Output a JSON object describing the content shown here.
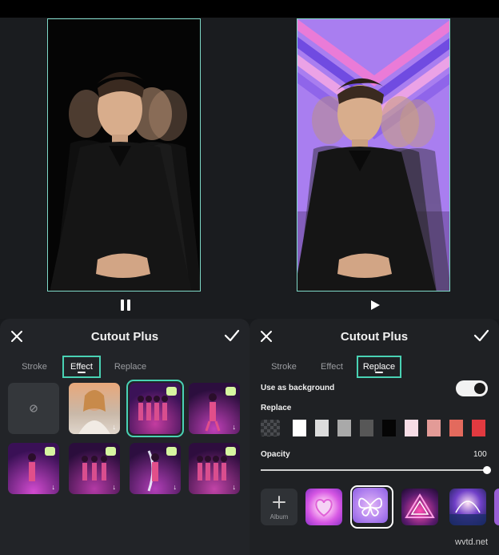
{
  "left_panel": {
    "title": "Cutout Plus",
    "tabs": [
      "Stroke",
      "Effect",
      "Replace"
    ],
    "active_tab": "Effect",
    "effects": [
      {
        "name": "none-effect-icon"
      },
      {
        "name": "portrait-effect",
        "download": "↓"
      },
      {
        "name": "dancer-trail-effect",
        "premium": true,
        "selected": true
      },
      {
        "name": "dancer-spotlight-effect",
        "premium": true,
        "download": "↓"
      },
      {
        "name": "dancer-neon-effect",
        "premium": true,
        "download": "↓"
      },
      {
        "name": "dancer-shadow-effect",
        "premium": true,
        "download": "↓"
      },
      {
        "name": "dancer-glow-effect",
        "premium": true,
        "download": "↓"
      },
      {
        "name": "dancer-echo-effect",
        "premium": true,
        "download": "↓"
      }
    ]
  },
  "right_panel": {
    "title": "Cutout Plus",
    "tabs": [
      "Stroke",
      "Effect",
      "Replace"
    ],
    "active_tab": "Replace",
    "use_as_background_label": "Use as background",
    "use_as_background_on": true,
    "replace_label": "Replace",
    "swatches": [
      "#ffffff",
      "#dcdcdc",
      "#a9a9a9",
      "#575757",
      "#050505",
      "#f6dde6",
      "#e39b97",
      "#e36a5d",
      "#e23a40"
    ],
    "opacity_label": "Opacity",
    "opacity_value": "100",
    "album_label": "Album",
    "backgrounds": [
      "heart-tunnel-bg",
      "butterfly-bg",
      "neon-triangle-bg",
      "neon-dome-bg"
    ],
    "selected_background": "butterfly-bg"
  },
  "watermark": "wvtd.net",
  "colors": {
    "accent": "#49d2b4",
    "premium": "#d6f5a0",
    "panel_bg": "#222428"
  }
}
